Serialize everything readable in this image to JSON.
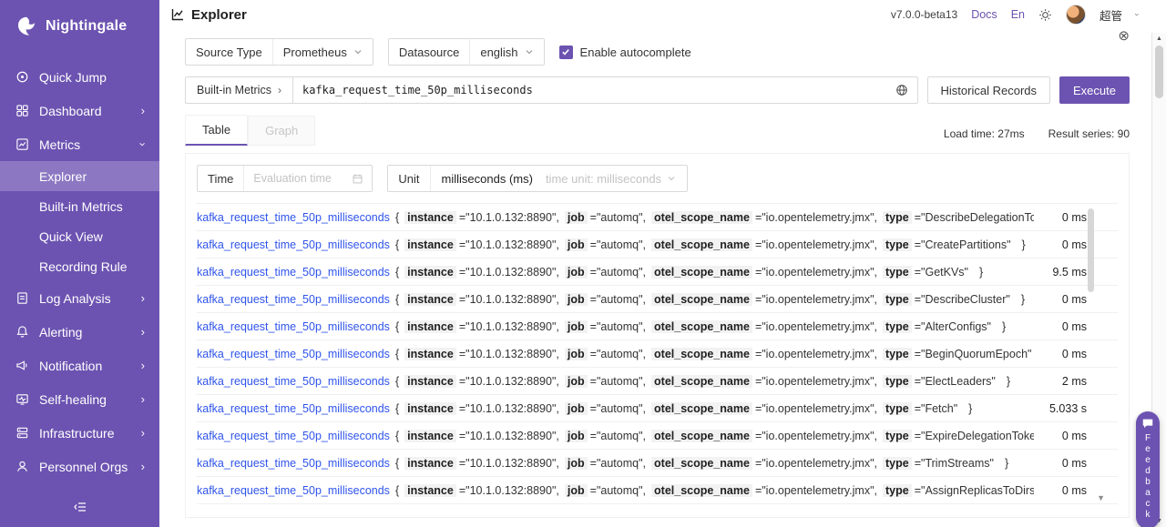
{
  "brand": {
    "color": "#6C53B1"
  },
  "sidebar": {
    "logo": "Nightingale",
    "items": [
      {
        "label": "Quick Jump"
      },
      {
        "label": "Dashboard"
      },
      {
        "label": "Metrics"
      },
      {
        "label": "Log Analysis"
      },
      {
        "label": "Alerting"
      },
      {
        "label": "Notification"
      },
      {
        "label": "Self-healing"
      },
      {
        "label": "Infrastructure"
      },
      {
        "label": "Personnel Orgs"
      }
    ],
    "metrics_children": [
      {
        "label": "Explorer"
      },
      {
        "label": "Built-in Metrics"
      },
      {
        "label": "Quick View"
      },
      {
        "label": "Recording Rule"
      }
    ]
  },
  "header": {
    "title": "Explorer",
    "version": "v7.0.0-beta13",
    "docs": "Docs",
    "lang": "En",
    "user": "超管"
  },
  "querybar": {
    "source_type_label": "Source Type",
    "source_type_value": "Prometheus",
    "datasource_label": "Datasource",
    "datasource_value": "english",
    "autocomplete_label": "Enable autocomplete",
    "builtin_metrics_button": "Built-in Metrics",
    "builtin_chevron": "›",
    "query_value": "kafka_request_time_50p_milliseconds",
    "historical_button": "Historical Records",
    "execute_button": "Execute"
  },
  "tabs": {
    "table": "Table",
    "graph": "Graph"
  },
  "stats": {
    "load_time": "Load time: 27ms",
    "result_series": "Result series: 90"
  },
  "panel": {
    "time_label": "Time",
    "time_placeholder": "Evaluation time",
    "unit_label": "Unit",
    "unit_value": "milliseconds (ms)",
    "unit_select": "time unit: milliseconds"
  },
  "syntax": {
    "open": "{",
    "close": "}",
    "eq": "=",
    "comma": ","
  },
  "series": {
    "metric": "kafka_request_time_50p_milliseconds",
    "labels": [
      {
        "key": "instance",
        "value": "\"10.1.0.132:8890\""
      },
      {
        "key": "job",
        "value": "\"automq\""
      },
      {
        "key": "otel_scope_name",
        "value": "\"io.opentelemetry.jmx\""
      }
    ],
    "type_key": "type",
    "rows": [
      {
        "type": "\"DescribeDelegationToken\"",
        "value": "0 ms"
      },
      {
        "type": "\"CreatePartitions\"",
        "value": "0 ms"
      },
      {
        "type": "\"GetKVs\"",
        "value": "9.5 ms"
      },
      {
        "type": "\"DescribeCluster\"",
        "value": "0 ms"
      },
      {
        "type": "\"AlterConfigs\"",
        "value": "0 ms"
      },
      {
        "type": "\"BeginQuorumEpoch\"",
        "value": "0 ms"
      },
      {
        "type": "\"ElectLeaders\"",
        "value": "2 ms"
      },
      {
        "type": "\"Fetch\"",
        "value": "5.033 s"
      },
      {
        "type": "\"ExpireDelegationToken\"",
        "value": "0 ms"
      },
      {
        "type": "\"TrimStreams\"",
        "value": "0 ms"
      },
      {
        "type": "\"AssignReplicasToDirs\"",
        "value": "0 ms"
      }
    ]
  },
  "feedback": {
    "label": "Feedback"
  }
}
